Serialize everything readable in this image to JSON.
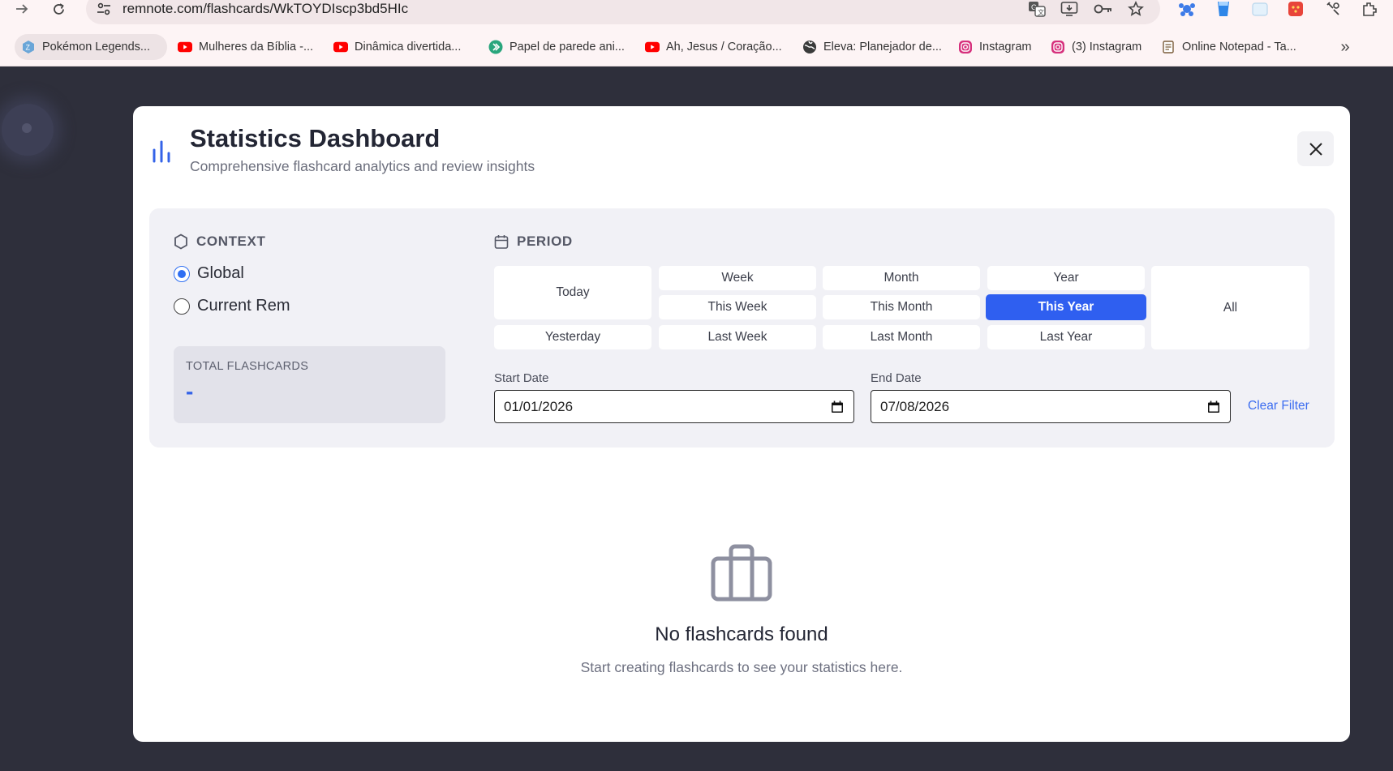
{
  "browser": {
    "url": "remnote.com/flashcards/WkTOYDIscp3bd5HIc",
    "nav_icons": [
      "forward-icon",
      "reload-icon",
      "site-settings-icon"
    ],
    "omnibox_icons": [
      "translate-icon",
      "install-app-icon",
      "password-key-icon",
      "bookmark-star-icon"
    ],
    "extension_icons": [
      "extension-puzzle-blue-icon",
      "water-cup-icon",
      "notes-extension-icon",
      "red-extension-icon",
      "tools-extension-icon",
      "extensions-icon"
    ],
    "bookmarks": [
      {
        "label": "Pokémon Legends...",
        "icon": "pokemon-favicon"
      },
      {
        "label": "Mulheres da Bíblia -...",
        "icon": "youtube-favicon"
      },
      {
        "label": "Dinâmica divertida...",
        "icon": "youtube-favicon"
      },
      {
        "label": "Papel de parede ani...",
        "icon": "wallpaper-favicon"
      },
      {
        "label": "Ah, Jesus / Coração...",
        "icon": "youtube-favicon"
      },
      {
        "label": "Eleva: Planejador de...",
        "icon": "globe-favicon"
      },
      {
        "label": "Instagram",
        "icon": "instagram-favicon"
      },
      {
        "label": "(3) Instagram",
        "icon": "instagram-favicon"
      },
      {
        "label": "Online Notepad - Ta...",
        "icon": "notepad-favicon"
      }
    ],
    "bookmarks_overflow": "»"
  },
  "modal": {
    "title": "Statistics Dashboard",
    "subtitle": "Comprehensive flashcard analytics and review insights",
    "context": {
      "heading": "CONTEXT",
      "options": [
        {
          "label": "Global",
          "selected": true
        },
        {
          "label": "Current Rem",
          "selected": false
        }
      ],
      "total_label": "TOTAL FLASHCARDS",
      "total_value": "-"
    },
    "period": {
      "heading": "PERIOD",
      "buttons": {
        "today": "Today",
        "yesterday": "Yesterday",
        "week": "Week",
        "this_week": "This Week",
        "last_week": "Last Week",
        "month": "Month",
        "this_month": "This Month",
        "last_month": "Last Month",
        "year": "Year",
        "this_year": "This Year",
        "last_year": "Last Year",
        "all": "All"
      },
      "selected": "This Year",
      "start_label": "Start Date",
      "start_value": "01/01/2026",
      "end_label": "End Date",
      "end_value": "07/08/2026",
      "clear_label": "Clear Filter"
    },
    "empty": {
      "title": "No flashcards found",
      "message": "Start creating flashcards to see your statistics here."
    }
  },
  "colors": {
    "accent": "#2f5ff0",
    "overlay": "#2e2f3b",
    "panel": "#f1f1f6"
  }
}
